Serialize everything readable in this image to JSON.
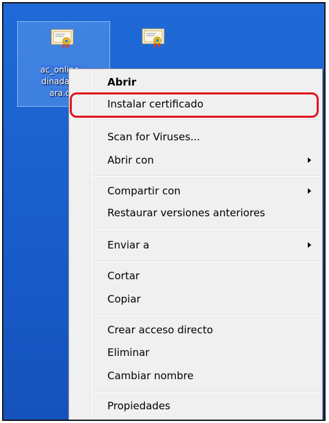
{
  "desktop": {
    "icons": [
      {
        "label_line1": "ac_online...",
        "label_line2": "dinada_c...",
        "label_line3": "ara.c..."
      },
      {
        "label_line1": "...",
        "label_line2": "",
        "label_line3": ""
      }
    ]
  },
  "context_menu": {
    "items": [
      {
        "label": "Abrir",
        "bold": true
      },
      {
        "label": "Instalar certificado",
        "highlighted": true
      },
      {
        "label": "Scan for Viruses..."
      },
      {
        "label": "Abrir con",
        "submenu": true
      },
      {
        "label": "Compartir con",
        "submenu": true
      },
      {
        "label": "Restaurar versiones anteriores"
      },
      {
        "label": "Enviar a",
        "submenu": true
      },
      {
        "label": "Cortar"
      },
      {
        "label": "Copiar"
      },
      {
        "label": "Crear acceso directo"
      },
      {
        "label": "Eliminar"
      },
      {
        "label": "Cambiar nombre"
      },
      {
        "label": "Propiedades"
      }
    ]
  },
  "colors": {
    "desktop_blue": "#1a5fcc",
    "menu_bg": "#f0f0f0",
    "highlight_red": "#e0161e"
  }
}
